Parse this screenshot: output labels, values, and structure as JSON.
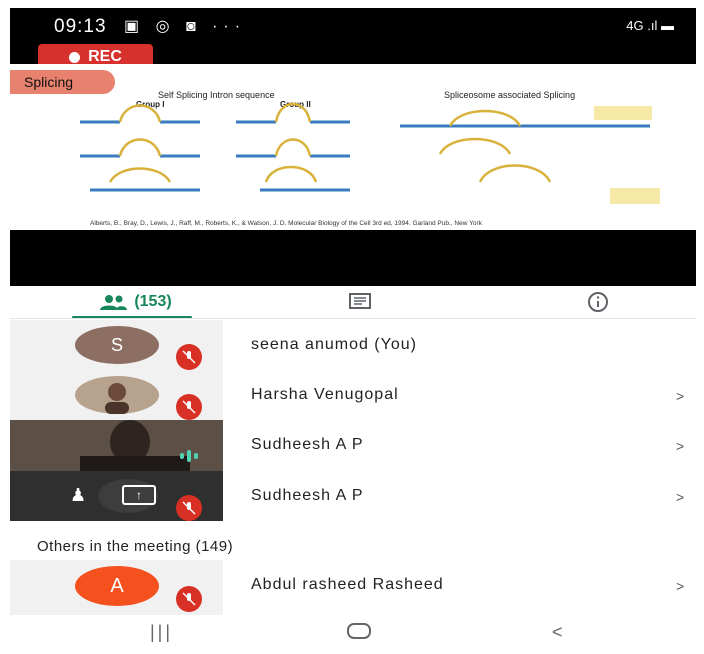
{
  "status": {
    "time": "09:13",
    "network": "4G"
  },
  "rec_label": "REC",
  "slide": {
    "tag": "Splicing",
    "left_title": "Self Splicing Intron sequence",
    "group1": "Group I",
    "group2": "Group II",
    "right_title": "Spliceosome associated Splicing",
    "citation": "Alberts, B., Bray, D., Lewis, J., Raff, M., Roberts, K., & Watson, J. D. Molecular Biology of the Cell 3rd ed, 1994. Garland Pub., New York"
  },
  "tabs": {
    "people_count": "(153)"
  },
  "participants": [
    {
      "name": "seena anumod (You)",
      "initial": "S",
      "avatar_color": "#8d6e63"
    },
    {
      "name": "Harsha Venugopal"
    },
    {
      "name": "Sudheesh A P"
    },
    {
      "name": "Sudheesh A P"
    }
  ],
  "others_heading": "Others in the meeting (149)",
  "others": [
    {
      "name": "Abdul rasheed Rasheed",
      "initial": "A",
      "avatar_color": "#f4511e"
    }
  ],
  "colors": {
    "accent": "#17865a",
    "mute": "#d93025",
    "rec": "#d6312c"
  }
}
